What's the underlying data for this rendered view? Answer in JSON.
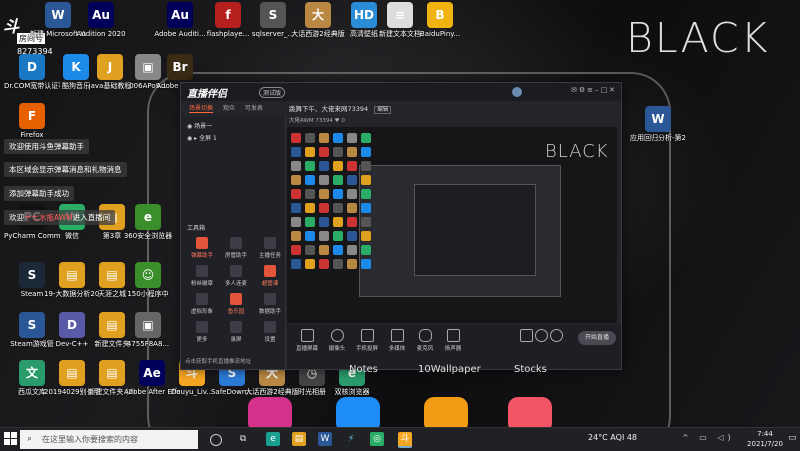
{
  "wallpaper": {
    "text": "BLACK"
  },
  "room_badge": {
    "number": "8273394",
    "label": "房间号"
  },
  "desktop_icons": [
    {
      "label": "新建 Microsoft Word 文档",
      "color": "#2b5797",
      "glyph": "W"
    },
    {
      "label": "Audition 2020",
      "color": "#00005b",
      "glyph": "Au"
    },
    {
      "label": "Adobe Auditi...",
      "color": "#00005b",
      "glyph": "Au"
    },
    {
      "label": "flashplaye...",
      "color": "#b5201e",
      "glyph": "f"
    },
    {
      "label": "sqlserver_...",
      "color": "#555",
      "glyph": "S"
    },
    {
      "label": "大话西游2经典版",
      "color": "#b84",
      "glyph": "大"
    },
    {
      "label": "高清壁纸",
      "color": "#2a8bd6",
      "glyph": "HD"
    },
    {
      "label": "新建文本文档",
      "color": "#ddd",
      "glyph": "≡"
    },
    {
      "label": "BaiduPiny...",
      "color": "#f0b30f",
      "glyph": "B"
    },
    {
      "label": "Dr.COM宽带认证客户端",
      "color": "#1b78c4",
      "glyph": "D"
    },
    {
      "label": "酷狗音乐",
      "color": "#1c8ae8",
      "glyph": "K"
    },
    {
      "label": "java基础教程",
      "color": "#e0a020",
      "glyph": "J"
    },
    {
      "label": "006APo9...",
      "color": "#888",
      "glyph": "▣"
    },
    {
      "label": "Adobe Bridge",
      "color": "#3a2c14",
      "glyph": "Br"
    },
    {
      "label": "Firefox",
      "color": "#e66000",
      "glyph": "F"
    },
    {
      "label": "PyCharm Communi...",
      "color": "#111",
      "glyph": "PC"
    },
    {
      "label": "微信",
      "color": "#2aae67",
      "glyph": "W"
    },
    {
      "label": "第3章",
      "color": "#e0a020",
      "glyph": "▤"
    },
    {
      "label": "360安全浏览器",
      "color": "#3a8f2c",
      "glyph": "e"
    },
    {
      "label": "Steam",
      "color": "#1b2838",
      "glyph": "S"
    },
    {
      "label": "19-大数据分析2019...",
      "color": "#e0a020",
      "glyph": "▤"
    },
    {
      "label": "天涯之城",
      "color": "#e0a020",
      "glyph": "▤"
    },
    {
      "label": "150小程序中",
      "color": "#3a8f2c",
      "glyph": "☺"
    },
    {
      "label": "Steam游戏管",
      "color": "#2b5797",
      "glyph": "S"
    },
    {
      "label": "Dev-C++",
      "color": "#5a5aa8",
      "glyph": "D"
    },
    {
      "label": "新建文件夹",
      "color": "#e0a020",
      "glyph": "▤"
    },
    {
      "label": "4755F8A8...",
      "color": "#666",
      "glyph": "▣"
    },
    {
      "label": "西瓜文库",
      "color": "#2a9c6c",
      "glyph": "文"
    },
    {
      "label": "20194029别长华每天-...",
      "color": "#e0a020",
      "glyph": "▤"
    },
    {
      "label": "新建文件夹 (2)",
      "color": "#e0a020",
      "glyph": "▤"
    },
    {
      "label": "Adobe After Effects 2020",
      "color": "#00005b",
      "glyph": "Ae"
    },
    {
      "label": "Douyu_Liv...",
      "color": "#f5a623",
      "glyph": "斗"
    },
    {
      "label": "SafeDown...",
      "color": "#2a7bd8",
      "glyph": "S"
    },
    {
      "label": "大话西游2经典版",
      "color": "#b84",
      "glyph": "大"
    },
    {
      "label": "时光相册",
      "color": "#444",
      "glyph": "◷"
    },
    {
      "label": "双核浏览器",
      "color": "#2a9c6c",
      "glyph": "e"
    },
    {
      "label": "应用回归分析-第2章课后...",
      "color": "#2b5797",
      "glyph": "W"
    }
  ],
  "notifications": [
    {
      "text": "欢迎使用斗鱼弹幕助手"
    },
    {
      "text": "本区域会显示弹幕消息和礼物消息"
    },
    {
      "text": "添加弹幕助手成功"
    },
    {
      "text_pre": "欢迎",
      "text_hl": "十七水瓶AWM",
      "text_post": "进入直播间"
    }
  ],
  "app": {
    "brand": "直播伴侣",
    "brand_tag": "测试版",
    "tabs": [
      "场景切换",
      "观众",
      "可发表"
    ],
    "scenes": [
      "场景一",
      "全屏 1"
    ],
    "stream_title": "跳舞下午、大佬来网73394",
    "stream_title_tag": "编辑",
    "stream_sub": "大佬AWM  73394  ♥ 0",
    "preview_wallpaper_text": "BLACK",
    "tools_title": "工具箱",
    "tools": [
      {
        "label": "弹幕助手",
        "hot": true
      },
      {
        "label": "房管助手",
        "hot": false
      },
      {
        "label": "主播任务",
        "hot": false
      },
      {
        "label": "粉丝徽章",
        "hot": false
      },
      {
        "label": "多人连麦",
        "hot": false
      },
      {
        "label": "超管课",
        "hot": true
      },
      {
        "label": "虚拟形象",
        "hot": false
      },
      {
        "label": "鱼乐园",
        "hot": true
      },
      {
        "label": "数据助手",
        "hot": false
      },
      {
        "label": "更多",
        "hot": false
      },
      {
        "label": "录屏",
        "hot": false
      },
      {
        "label": "设置",
        "hot": false
      }
    ],
    "left_footer": "点击获取手机直播推流地址",
    "bottom_items": [
      "直播屏幕",
      "摄像头",
      "手机投屏",
      "多媒体",
      "麦克风",
      "扬声器"
    ],
    "go_live": "开始直播"
  },
  "dock_labels": [
    "Notes",
    "10Wallpaper",
    "Stocks"
  ],
  "taskbar": {
    "search_placeholder": "在这里输入你要搜索的内容",
    "weather": "24°C AQI 48",
    "time": "7:44",
    "date": "2021/7/20"
  }
}
